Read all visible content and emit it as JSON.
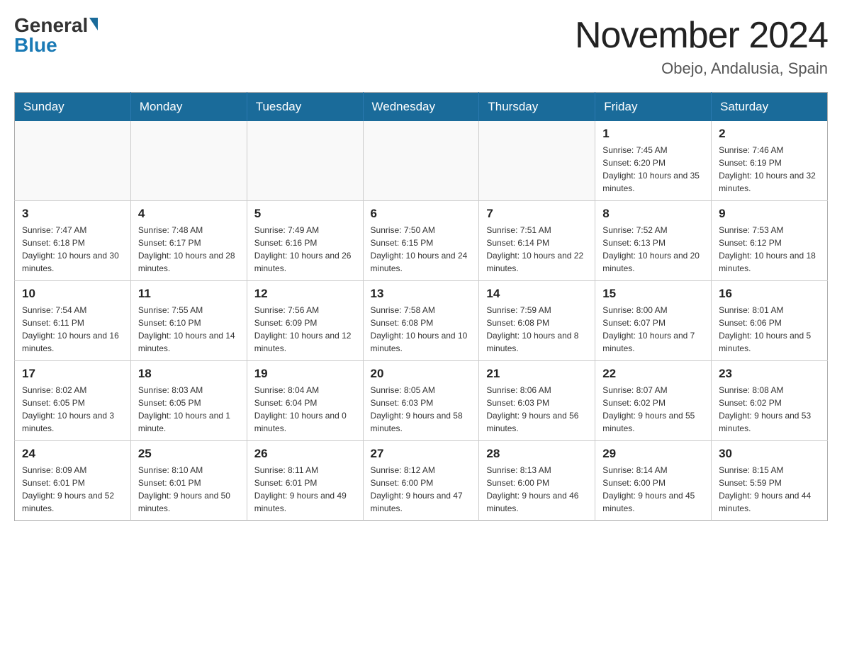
{
  "header": {
    "logo_general": "General",
    "logo_blue": "Blue",
    "title": "November 2024",
    "subtitle": "Obejo, Andalusia, Spain"
  },
  "weekdays": [
    "Sunday",
    "Monday",
    "Tuesday",
    "Wednesday",
    "Thursday",
    "Friday",
    "Saturday"
  ],
  "weeks": [
    [
      {
        "day": "",
        "sunrise": "",
        "sunset": "",
        "daylight": ""
      },
      {
        "day": "",
        "sunrise": "",
        "sunset": "",
        "daylight": ""
      },
      {
        "day": "",
        "sunrise": "",
        "sunset": "",
        "daylight": ""
      },
      {
        "day": "",
        "sunrise": "",
        "sunset": "",
        "daylight": ""
      },
      {
        "day": "",
        "sunrise": "",
        "sunset": "",
        "daylight": ""
      },
      {
        "day": "1",
        "sunrise": "Sunrise: 7:45 AM",
        "sunset": "Sunset: 6:20 PM",
        "daylight": "Daylight: 10 hours and 35 minutes."
      },
      {
        "day": "2",
        "sunrise": "Sunrise: 7:46 AM",
        "sunset": "Sunset: 6:19 PM",
        "daylight": "Daylight: 10 hours and 32 minutes."
      }
    ],
    [
      {
        "day": "3",
        "sunrise": "Sunrise: 7:47 AM",
        "sunset": "Sunset: 6:18 PM",
        "daylight": "Daylight: 10 hours and 30 minutes."
      },
      {
        "day": "4",
        "sunrise": "Sunrise: 7:48 AM",
        "sunset": "Sunset: 6:17 PM",
        "daylight": "Daylight: 10 hours and 28 minutes."
      },
      {
        "day": "5",
        "sunrise": "Sunrise: 7:49 AM",
        "sunset": "Sunset: 6:16 PM",
        "daylight": "Daylight: 10 hours and 26 minutes."
      },
      {
        "day": "6",
        "sunrise": "Sunrise: 7:50 AM",
        "sunset": "Sunset: 6:15 PM",
        "daylight": "Daylight: 10 hours and 24 minutes."
      },
      {
        "day": "7",
        "sunrise": "Sunrise: 7:51 AM",
        "sunset": "Sunset: 6:14 PM",
        "daylight": "Daylight: 10 hours and 22 minutes."
      },
      {
        "day": "8",
        "sunrise": "Sunrise: 7:52 AM",
        "sunset": "Sunset: 6:13 PM",
        "daylight": "Daylight: 10 hours and 20 minutes."
      },
      {
        "day": "9",
        "sunrise": "Sunrise: 7:53 AM",
        "sunset": "Sunset: 6:12 PM",
        "daylight": "Daylight: 10 hours and 18 minutes."
      }
    ],
    [
      {
        "day": "10",
        "sunrise": "Sunrise: 7:54 AM",
        "sunset": "Sunset: 6:11 PM",
        "daylight": "Daylight: 10 hours and 16 minutes."
      },
      {
        "day": "11",
        "sunrise": "Sunrise: 7:55 AM",
        "sunset": "Sunset: 6:10 PM",
        "daylight": "Daylight: 10 hours and 14 minutes."
      },
      {
        "day": "12",
        "sunrise": "Sunrise: 7:56 AM",
        "sunset": "Sunset: 6:09 PM",
        "daylight": "Daylight: 10 hours and 12 minutes."
      },
      {
        "day": "13",
        "sunrise": "Sunrise: 7:58 AM",
        "sunset": "Sunset: 6:08 PM",
        "daylight": "Daylight: 10 hours and 10 minutes."
      },
      {
        "day": "14",
        "sunrise": "Sunrise: 7:59 AM",
        "sunset": "Sunset: 6:08 PM",
        "daylight": "Daylight: 10 hours and 8 minutes."
      },
      {
        "day": "15",
        "sunrise": "Sunrise: 8:00 AM",
        "sunset": "Sunset: 6:07 PM",
        "daylight": "Daylight: 10 hours and 7 minutes."
      },
      {
        "day": "16",
        "sunrise": "Sunrise: 8:01 AM",
        "sunset": "Sunset: 6:06 PM",
        "daylight": "Daylight: 10 hours and 5 minutes."
      }
    ],
    [
      {
        "day": "17",
        "sunrise": "Sunrise: 8:02 AM",
        "sunset": "Sunset: 6:05 PM",
        "daylight": "Daylight: 10 hours and 3 minutes."
      },
      {
        "day": "18",
        "sunrise": "Sunrise: 8:03 AM",
        "sunset": "Sunset: 6:05 PM",
        "daylight": "Daylight: 10 hours and 1 minute."
      },
      {
        "day": "19",
        "sunrise": "Sunrise: 8:04 AM",
        "sunset": "Sunset: 6:04 PM",
        "daylight": "Daylight: 10 hours and 0 minutes."
      },
      {
        "day": "20",
        "sunrise": "Sunrise: 8:05 AM",
        "sunset": "Sunset: 6:03 PM",
        "daylight": "Daylight: 9 hours and 58 minutes."
      },
      {
        "day": "21",
        "sunrise": "Sunrise: 8:06 AM",
        "sunset": "Sunset: 6:03 PM",
        "daylight": "Daylight: 9 hours and 56 minutes."
      },
      {
        "day": "22",
        "sunrise": "Sunrise: 8:07 AM",
        "sunset": "Sunset: 6:02 PM",
        "daylight": "Daylight: 9 hours and 55 minutes."
      },
      {
        "day": "23",
        "sunrise": "Sunrise: 8:08 AM",
        "sunset": "Sunset: 6:02 PM",
        "daylight": "Daylight: 9 hours and 53 minutes."
      }
    ],
    [
      {
        "day": "24",
        "sunrise": "Sunrise: 8:09 AM",
        "sunset": "Sunset: 6:01 PM",
        "daylight": "Daylight: 9 hours and 52 minutes."
      },
      {
        "day": "25",
        "sunrise": "Sunrise: 8:10 AM",
        "sunset": "Sunset: 6:01 PM",
        "daylight": "Daylight: 9 hours and 50 minutes."
      },
      {
        "day": "26",
        "sunrise": "Sunrise: 8:11 AM",
        "sunset": "Sunset: 6:01 PM",
        "daylight": "Daylight: 9 hours and 49 minutes."
      },
      {
        "day": "27",
        "sunrise": "Sunrise: 8:12 AM",
        "sunset": "Sunset: 6:00 PM",
        "daylight": "Daylight: 9 hours and 47 minutes."
      },
      {
        "day": "28",
        "sunrise": "Sunrise: 8:13 AM",
        "sunset": "Sunset: 6:00 PM",
        "daylight": "Daylight: 9 hours and 46 minutes."
      },
      {
        "day": "29",
        "sunrise": "Sunrise: 8:14 AM",
        "sunset": "Sunset: 6:00 PM",
        "daylight": "Daylight: 9 hours and 45 minutes."
      },
      {
        "day": "30",
        "sunrise": "Sunrise: 8:15 AM",
        "sunset": "Sunset: 5:59 PM",
        "daylight": "Daylight: 9 hours and 44 minutes."
      }
    ]
  ]
}
